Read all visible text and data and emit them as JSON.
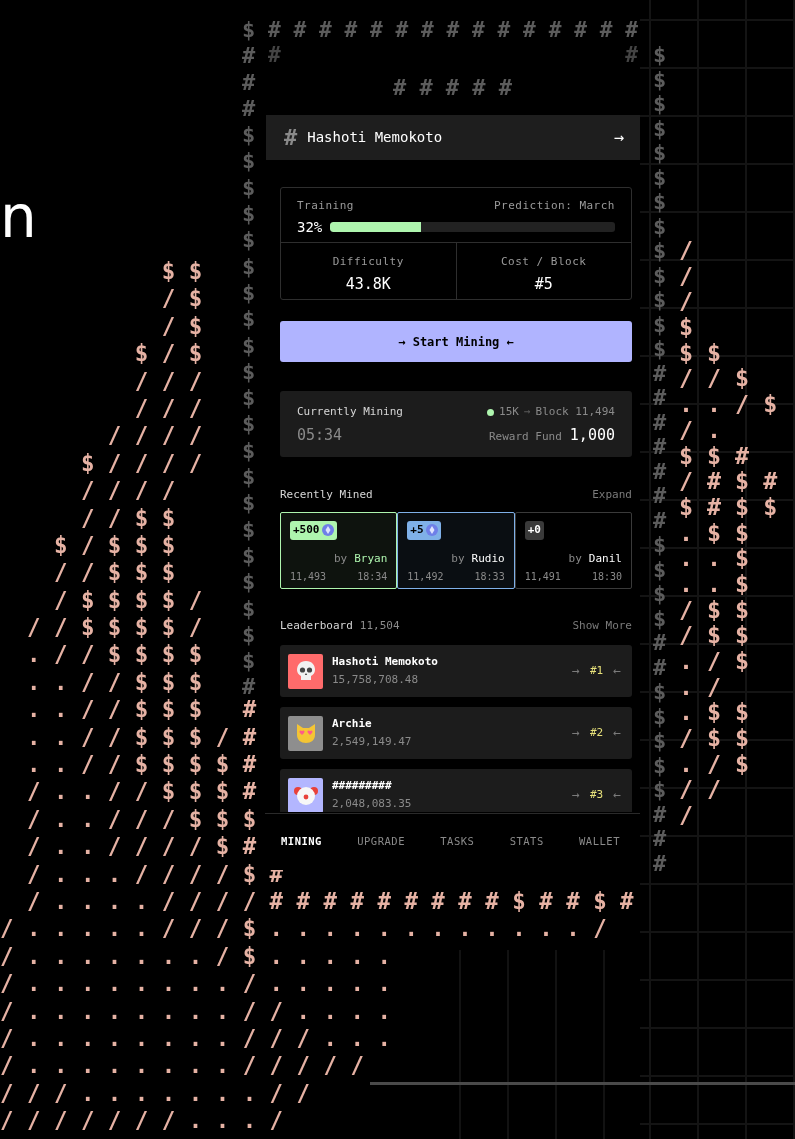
{
  "backdrop": {
    "edge_letter": "n",
    "left_art": [
      "            $ $",
      "            / $",
      "            / $",
      "          $ / $",
      "          / / /",
      "          / / /",
      "        / / / /",
      "      $ / / / /",
      "      / / / /",
      "      / / $ $",
      "    $ / $ $ $",
      "    / / $ $ $",
      "    / $ $ $ $ /",
      "  / / $ $ $ $ /",
      "  . / / $ $ $ $",
      "  . . / / $ $ $",
      "  . . / / $ $ $   #",
      "  . . / / $ $ $ / #",
      "  . . / / $ $ $ $ #",
      "  / . . / / $ $ $ #",
      "  / . . / / / $ $ $",
      "  / . . / / / / $ #",
      "  / . . . / / / / $ #",
      "  / . . . . / / / / # # # # # # # # # $ # # $ #",
      "/ . . . . . / / / $ . . . . . . . . . . . . /",
      "/ . . . . . . . / $ . . . . .",
      "/ . . . . . . . . / . . . . .",
      "/ . . . . . . . . / / . . . .",
      "/ . . . . . . . . / / / . . .",
      "/ . . . . . . . . / / / / /",
      "/ / / . . . . . . . / /",
      "/ / / / / / / . . . /"
    ],
    "right_art": [
      "/",
      "/",
      "/",
      "$",
      "$ $",
      "/ / $",
      ". . / $",
      "/ .",
      "$ $ #",
      "/ # $ #",
      "$ # $ $",
      ". $ $",
      ". . $",
      ". . $",
      "/ $ $",
      "/ $ $",
      ". / $",
      ". /",
      ". $ $",
      "/ $ $",
      ". / $",
      "/ /",
      "/"
    ]
  },
  "frame": {
    "top": "# # # # # # # # # # # # # # #",
    "second_row": "#                           #",
    "left": "$###$$$$$$$$$$$$$$$$$$$$$#",
    "right": "$$$$$$$$$$$$$#######$$$$##$$$$$###"
  },
  "header": {
    "title": "# # # # #",
    "account_icon": "#",
    "account_name": "Hashoti Memokoto",
    "arrow": "→"
  },
  "training": {
    "label": "Training",
    "prediction": "Prediction: March",
    "percent": "32%",
    "level": 0.32
  },
  "stats": [
    {
      "label": "Difficulty",
      "value": "43.8K"
    },
    {
      "label": "Cost / Block",
      "value": "#5"
    }
  ],
  "start_button": "→ Start Mining ←",
  "current": {
    "label": "Currently Mining",
    "timer": "05:34",
    "active": true,
    "amount": "15K",
    "arrow": "→",
    "block": "Block 11,494",
    "fund_label": "Reward Fund",
    "fund_value": "1,000"
  },
  "recent": {
    "title": "Recently Mined",
    "action": "Expand",
    "cards": [
      {
        "reward": "+500",
        "coin": true,
        "color": "#aef5ae",
        "by": "by",
        "miner": "Bryan",
        "miner_highlight": true,
        "block": "11,493",
        "time": "18:34"
      },
      {
        "reward": "+5",
        "coin": true,
        "color": "#7fb0e8",
        "by": "by",
        "miner": "Rudio",
        "miner_highlight": false,
        "block": "11,492",
        "time": "18:33"
      },
      {
        "reward": "+0",
        "coin": false,
        "color": "#3a3a3a",
        "by": "by",
        "miner": "Danil",
        "miner_highlight": false,
        "block": "11,491",
        "time": "18:30"
      }
    ]
  },
  "leaderboard": {
    "title": "Leaderboard",
    "count": "11,504",
    "action": "Show More",
    "rows": [
      {
        "kind": "skull",
        "color": "#ff6b6b",
        "name": "Hashoti Memokoto",
        "score": "15,758,708.48",
        "left_arrow": "→",
        "rank": "#1",
        "right_arrow": "←"
      },
      {
        "kind": "cat",
        "color": "#8e8e8e",
        "name": "Archie",
        "score": "2,549,149.47",
        "left_arrow": "→",
        "rank": "#2",
        "right_arrow": "←"
      },
      {
        "kind": "clown",
        "color": "#b3b6ff",
        "name": "#########",
        "score": "2,048,083.35",
        "left_arrow": "→",
        "rank": "#3",
        "right_arrow": "←"
      }
    ]
  },
  "nav": [
    {
      "label": "MINING",
      "selected": true
    },
    {
      "label": "UPGRADE",
      "selected": false
    },
    {
      "label": "TASKS",
      "selected": false
    },
    {
      "label": "STATS",
      "selected": false
    },
    {
      "label": "WALLET",
      "selected": false
    }
  ]
}
